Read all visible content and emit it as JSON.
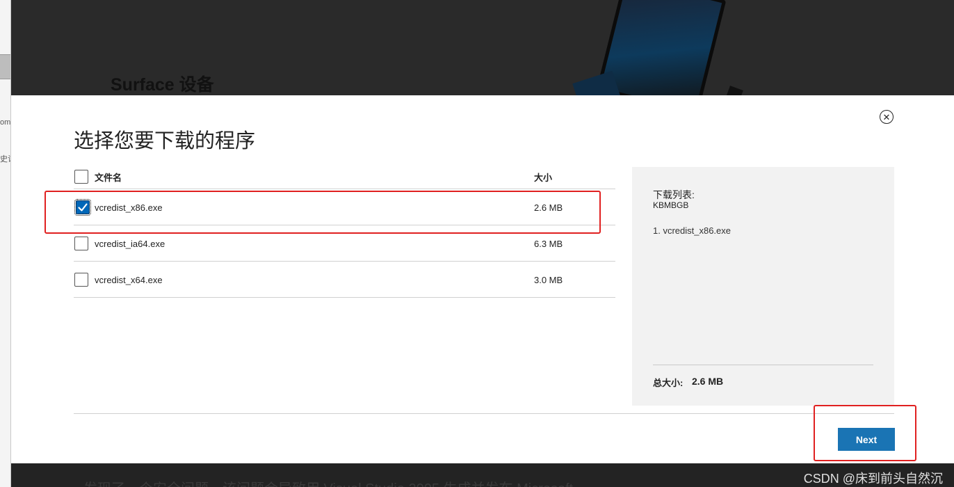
{
  "background": {
    "section_title": "Surface 设备",
    "bottom_text": "发现了一个安全问题，该问题会导致用 Visual Studio 2005 生成并发布 Microsoft",
    "left_fragments": [
      "om",
      "史记"
    ]
  },
  "watermark": "CSDN @床到前头自然沉",
  "dialog": {
    "title": "选择您要下载的程序",
    "close_glyph": "✕",
    "columns": {
      "name": "文件名",
      "size": "大小"
    },
    "files": [
      {
        "name": "vcredist_x86.exe",
        "size": "2.6 MB",
        "checked": true
      },
      {
        "name": "vcredist_ia64.exe",
        "size": "6.3 MB",
        "checked": false
      },
      {
        "name": "vcredist_x64.exe",
        "size": "3.0 MB",
        "checked": false
      }
    ],
    "download_list": {
      "title": "下载列表:",
      "subtitle": "KBMBGB",
      "items": [
        "1. vcredist_x86.exe"
      ],
      "total_label": "总大小:",
      "total_value": "2.6 MB"
    },
    "next_label": "Next"
  },
  "colors": {
    "accent": "#1a74b4",
    "checkbox_checked": "#0067b8",
    "annotation": "#e02020"
  }
}
